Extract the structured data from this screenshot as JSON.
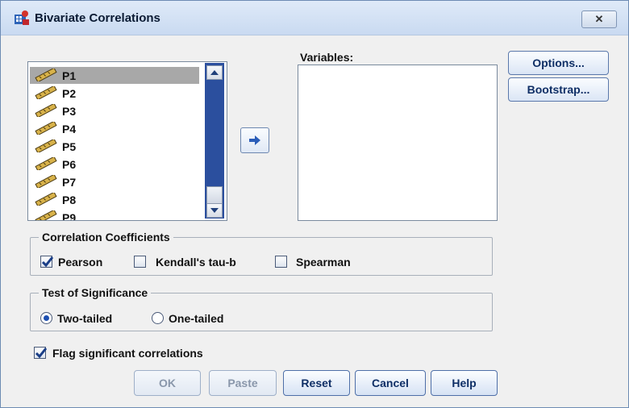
{
  "window": {
    "title": "Bivariate Correlations",
    "close_label": "✕"
  },
  "variable_list": {
    "items": [
      "P1",
      "P2",
      "P3",
      "P4",
      "P5",
      "P6",
      "P7",
      "P8",
      "P9"
    ],
    "selected": "P1"
  },
  "variables": {
    "label": "Variables:"
  },
  "side_buttons": {
    "options": "Options...",
    "bootstrap": "Bootstrap..."
  },
  "correlation": {
    "title": "Correlation Coefficients",
    "pearson": {
      "label": "Pearson",
      "checked": true
    },
    "kendall": {
      "label": "Kendall's tau-b",
      "checked": false
    },
    "spearman": {
      "label": "Spearman",
      "checked": false
    }
  },
  "significance": {
    "title": "Test of Significance",
    "two_tailed": {
      "label": "Two-tailed",
      "selected": true
    },
    "one_tailed": {
      "label": "One-tailed",
      "selected": false
    }
  },
  "flag": {
    "label": "Flag significant correlations",
    "checked": true
  },
  "buttons": {
    "ok": "OK",
    "paste": "Paste",
    "reset": "Reset",
    "cancel": "Cancel",
    "help": "Help"
  }
}
